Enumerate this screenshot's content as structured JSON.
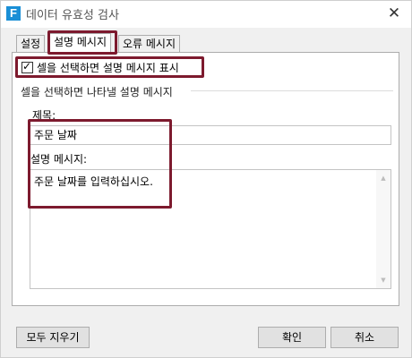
{
  "window": {
    "title": "데이터 유효성 검사",
    "app_icon_letter": "F",
    "close_symbol": "✕"
  },
  "tabs": [
    {
      "label": "설정",
      "active": false
    },
    {
      "label": "설명 메시지",
      "active": true
    },
    {
      "label": "오류 메시지",
      "active": false
    }
  ],
  "input_message": {
    "show_checkbox": {
      "checked": true,
      "label": "셀을 선택하면 설명 메시지 표시",
      "mark": "✓"
    },
    "group_title": "셀을 선택하면 나타낼 설명 메시지",
    "title_label": "제목:",
    "title_value": "주문 날짜",
    "message_label": "설명 메시지:",
    "message_value": "주문 날짜를 입력하십시오."
  },
  "scrollbar": {
    "up_symbol": "▲",
    "down_symbol": "▼"
  },
  "buttons": {
    "clear_all": "모두 지우기",
    "ok": "확인",
    "cancel": "취소"
  },
  "colors": {
    "highlight": "#7d1a2e",
    "app_icon": "#1a8fd6"
  }
}
